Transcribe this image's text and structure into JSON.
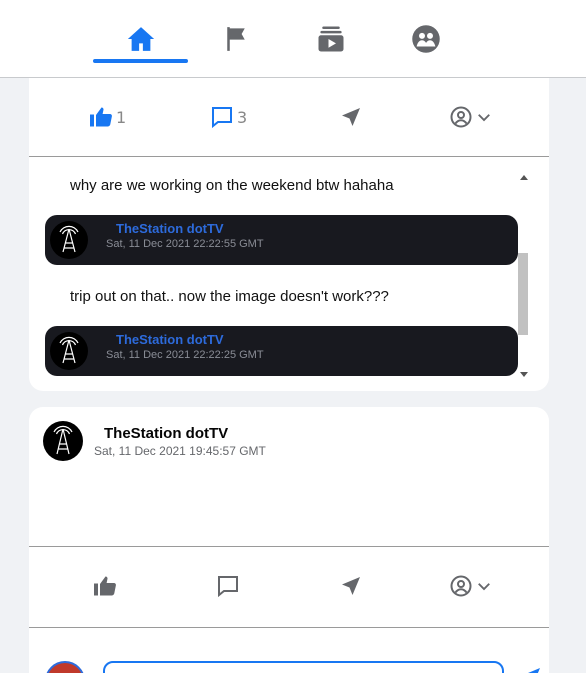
{
  "nav": {
    "tabs": [
      {
        "icon": "home-icon",
        "active": true
      },
      {
        "icon": "flag-icon",
        "active": false
      },
      {
        "icon": "watch-icon",
        "active": false
      },
      {
        "icon": "groups-icon",
        "active": false
      }
    ],
    "active_color": "#1877f2",
    "inactive_color": "#65676b"
  },
  "post1": {
    "actions": {
      "like_count": "1",
      "comment_count": "3",
      "like_active": true
    },
    "comments": [
      {
        "text": "why are we working on the weekend btw hahaha",
        "author": "TheStation dotTV",
        "timestamp": "Sat, 11 Dec 2021 22:22:55 GMT"
      },
      {
        "text": "trip out on that.. now the image doesn't work???",
        "author": "TheStation dotTV",
        "timestamp": "Sat, 11 Dec 2021 22:22:25 GMT"
      }
    ]
  },
  "post2": {
    "author": "TheStation dotTV",
    "timestamp": "Sat, 11 Dec 2021 19:45:57 GMT",
    "compose": {
      "value": "",
      "placeholder": ""
    }
  },
  "colors": {
    "accent": "#1877f2",
    "comment_bg": "#18191f",
    "comment_name": "#2d6bdc"
  }
}
